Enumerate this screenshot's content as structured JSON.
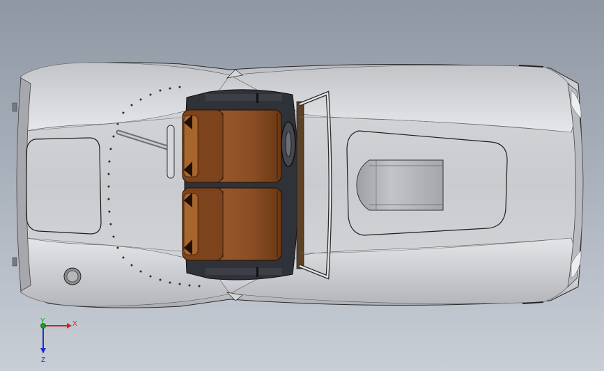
{
  "viewport": {
    "background_top": "#8f97a3",
    "background_bottom": "#c9ced6"
  },
  "model": {
    "body_color": "#c4c6cb",
    "seat_color": "#8a4e24",
    "interior_color": "#2f3238"
  },
  "triad": {
    "x_label": "X",
    "y_label": "Y",
    "z_label": "Z",
    "x_color": "#d42020",
    "y_color": "#18a018",
    "z_color": "#2030c8"
  }
}
